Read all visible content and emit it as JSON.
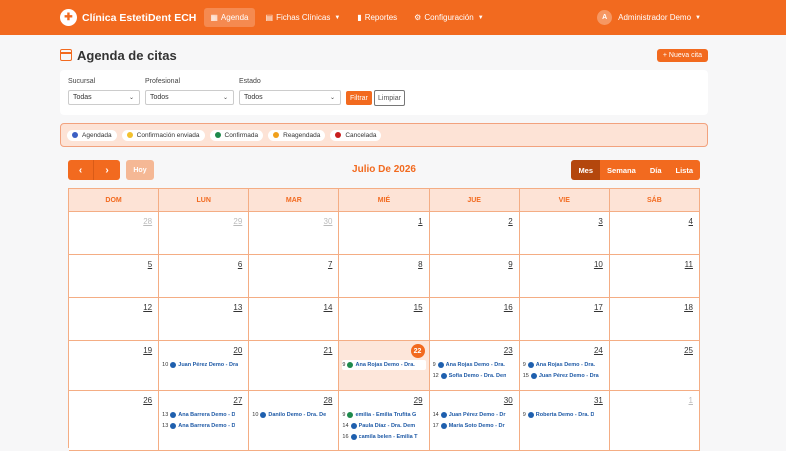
{
  "brand": {
    "name": "Clínica EstetiDent ECH",
    "logo_text": "🦷"
  },
  "nav": [
    {
      "label": "Agenda",
      "icon": "calendar-icon",
      "active": true
    },
    {
      "label": "Fichas Clínicas",
      "icon": "folder-icon",
      "active": false,
      "dropdown": true
    },
    {
      "label": "Reportes",
      "icon": "bar-chart-icon",
      "active": false
    },
    {
      "label": "Configuración",
      "icon": "gear-icon",
      "active": false,
      "dropdown": true
    }
  ],
  "user": {
    "initial": "A",
    "name": "Administrador Demo"
  },
  "page": {
    "title": "Agenda de citas",
    "new_button": "+ Nueva cita"
  },
  "filters": {
    "sucursal": {
      "label": "Sucursal",
      "value": "Todas"
    },
    "profesional": {
      "label": "Profesional",
      "value": "Todos"
    },
    "estado": {
      "label": "Estado",
      "value": "Todos"
    },
    "filter_button": "Filtrar",
    "clear_button": "Limpiar"
  },
  "legend": [
    {
      "label": "Agendada",
      "color": "#3b5fc4"
    },
    {
      "label": "Confirmación enviada",
      "color": "#f2c12e"
    },
    {
      "label": "Confirmada",
      "color": "#1e8a4c"
    },
    {
      "label": "Reagendada",
      "color": "#f0a01c"
    },
    {
      "label": "Cancelada",
      "color": "#c81e1e"
    }
  ],
  "calendar": {
    "title": "Julio De 2026",
    "today_button": "Hoy",
    "prev": "‹",
    "next": "›",
    "views": [
      "Mes",
      "Semana",
      "Día",
      "Lista"
    ],
    "weekdays": [
      "DOM",
      "LUN",
      "MAR",
      "MIÉ",
      "JUE",
      "VIE",
      "SÁB"
    ]
  },
  "weeks": [
    {
      "days": [
        {
          "n": "28",
          "other": true
        },
        {
          "n": "29",
          "other": true
        },
        {
          "n": "30",
          "other": true
        },
        {
          "n": "1"
        },
        {
          "n": "2"
        },
        {
          "n": "3"
        },
        {
          "n": "4"
        }
      ]
    },
    {
      "days": [
        {
          "n": "5"
        },
        {
          "n": "6"
        },
        {
          "n": "7"
        },
        {
          "n": "8"
        },
        {
          "n": "9"
        },
        {
          "n": "10"
        },
        {
          "n": "11"
        }
      ]
    },
    {
      "days": [
        {
          "n": "12"
        },
        {
          "n": "13"
        },
        {
          "n": "14"
        },
        {
          "n": "15"
        },
        {
          "n": "16"
        },
        {
          "n": "17"
        },
        {
          "n": "18"
        }
      ]
    },
    {
      "days": [
        {
          "n": "19"
        },
        {
          "n": "20",
          "events": [
            {
              "t": "10",
              "c": "#1e5fae",
              "name": "Juan Pérez Demo - Dra"
            }
          ]
        },
        {
          "n": "21"
        },
        {
          "n": "22",
          "today": true,
          "events": [
            {
              "t": "9",
              "c": "#1e8a4c",
              "name": "Ana Rojas Demo - Dra."
            }
          ]
        },
        {
          "n": "23",
          "events": [
            {
              "t": "9",
              "c": "#1e5fae",
              "name": "Ana Rojas Demo - Dra."
            },
            {
              "t": "12",
              "c": "#1e5fae",
              "name": "Sofía Demo - Dra. Den"
            }
          ]
        },
        {
          "n": "24",
          "events": [
            {
              "t": "9",
              "c": "#1e5fae",
              "name": "Ana Rojas Demo - Dra."
            },
            {
              "t": "15",
              "c": "#1e5fae",
              "name": "Juan Pérez Demo - Dra"
            }
          ]
        },
        {
          "n": "25"
        }
      ]
    },
    {
      "days": [
        {
          "n": "26"
        },
        {
          "n": "27",
          "events": [
            {
              "t": "13",
              "c": "#1e5fae",
              "name": "Ana Barrera Demo - D"
            },
            {
              "t": "13",
              "c": "#1e5fae",
              "name": "Ana Barrera Demo - D"
            }
          ]
        },
        {
          "n": "28",
          "events": [
            {
              "t": "10",
              "c": "#1e5fae",
              "name": "Danilo Demo - Dra. De"
            }
          ]
        },
        {
          "n": "29",
          "events": [
            {
              "t": "9",
              "c": "#1e8a4c",
              "name": "emilia - Emilia Trufita G"
            },
            {
              "t": "14",
              "c": "#1e5fae",
              "name": "Paula Díaz - Dra. Dem"
            },
            {
              "t": "16",
              "c": "#1e5fae",
              "name": "camila belen - Emilia T"
            }
          ]
        },
        {
          "n": "30",
          "events": [
            {
              "t": "14",
              "c": "#1e5fae",
              "name": "Juan Pérez Demo - Dr"
            },
            {
              "t": "17",
              "c": "#1e5fae",
              "name": "María Soto Demo - Dr"
            }
          ]
        },
        {
          "n": "31",
          "events": [
            {
              "t": "9",
              "c": "#1e5fae",
              "name": "Roberta Demo - Dra. D"
            }
          ]
        },
        {
          "n": "1",
          "other": true
        }
      ]
    }
  ]
}
